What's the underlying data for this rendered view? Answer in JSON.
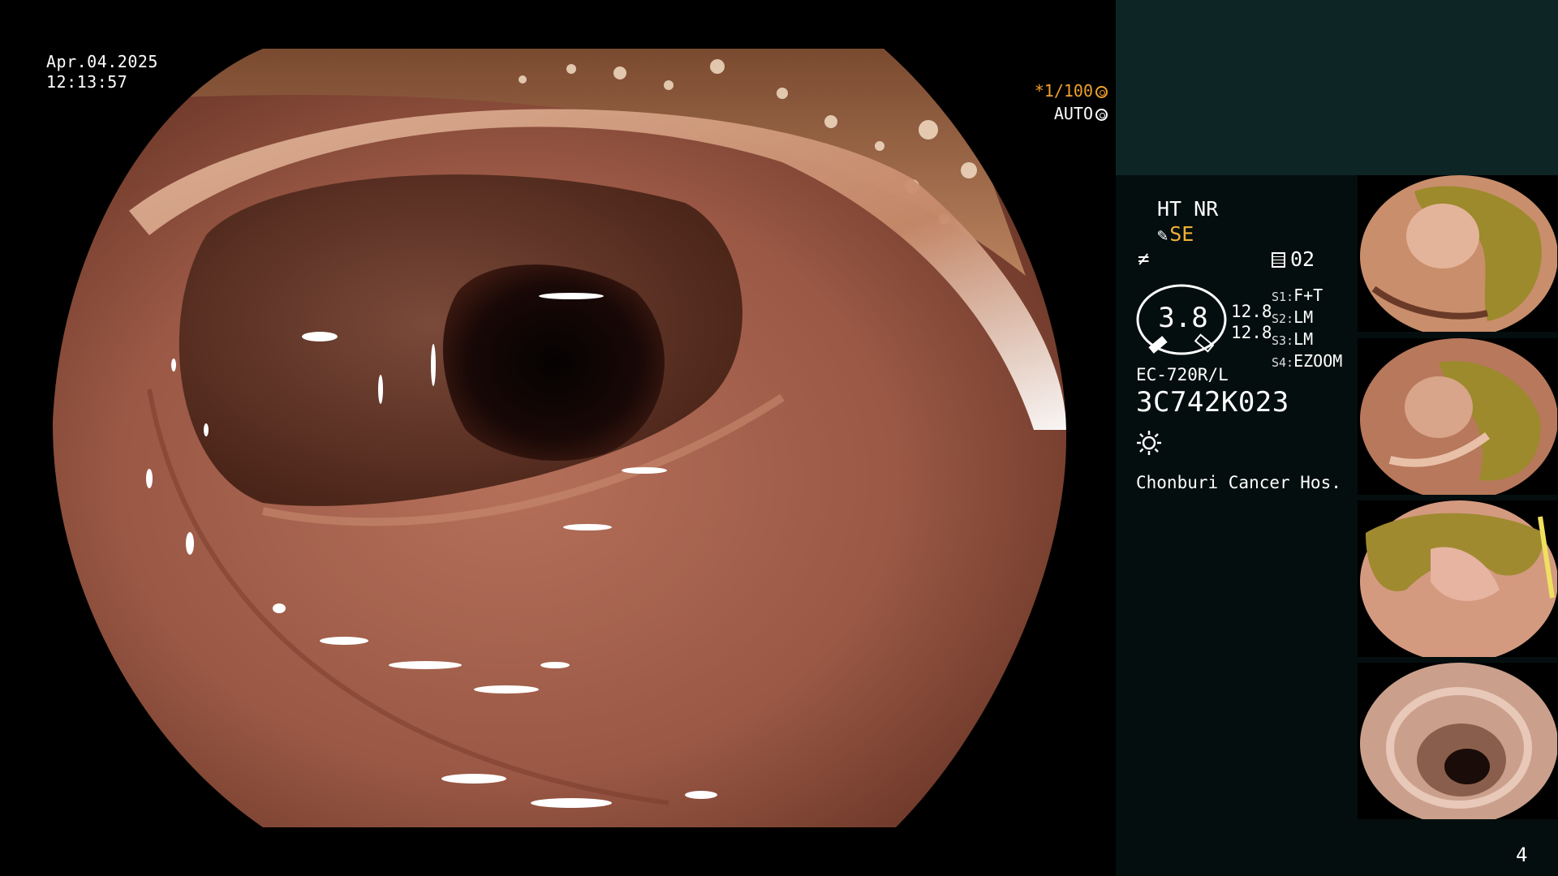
{
  "overlay": {
    "date": "Apr.04.2025",
    "time": "12:13:57",
    "shutter_speed": "*1/100",
    "exposure_mode": "AUTO"
  },
  "panel": {
    "enhance_mode": "HT NR",
    "structure_mode": "SE",
    "memo_number": "02",
    "gauge_value": "3.8",
    "gauge_values": [
      "12.8",
      "12.8"
    ],
    "scene_keys": [
      "S1:",
      "S2:",
      "S3:",
      "S4:"
    ],
    "scene_values": [
      "F+T",
      "LM",
      "LM",
      "EZOOM"
    ],
    "scope_model": "EC-720R/L",
    "scope_serial": "3C742K023",
    "hospital": "Chonburi Cancer Hos."
  },
  "page_number": "4",
  "icons": {
    "pen": "pen-icon",
    "no-freeze": "slash-icon",
    "memo": "memo-icon",
    "light": "sun-icon",
    "shutter": "aperture-icon",
    "exposure": "iris-icon"
  },
  "colors": {
    "accent_orange": "#f0b036",
    "panel_top": "#0e2525",
    "panel_bg": "#040e0e"
  }
}
